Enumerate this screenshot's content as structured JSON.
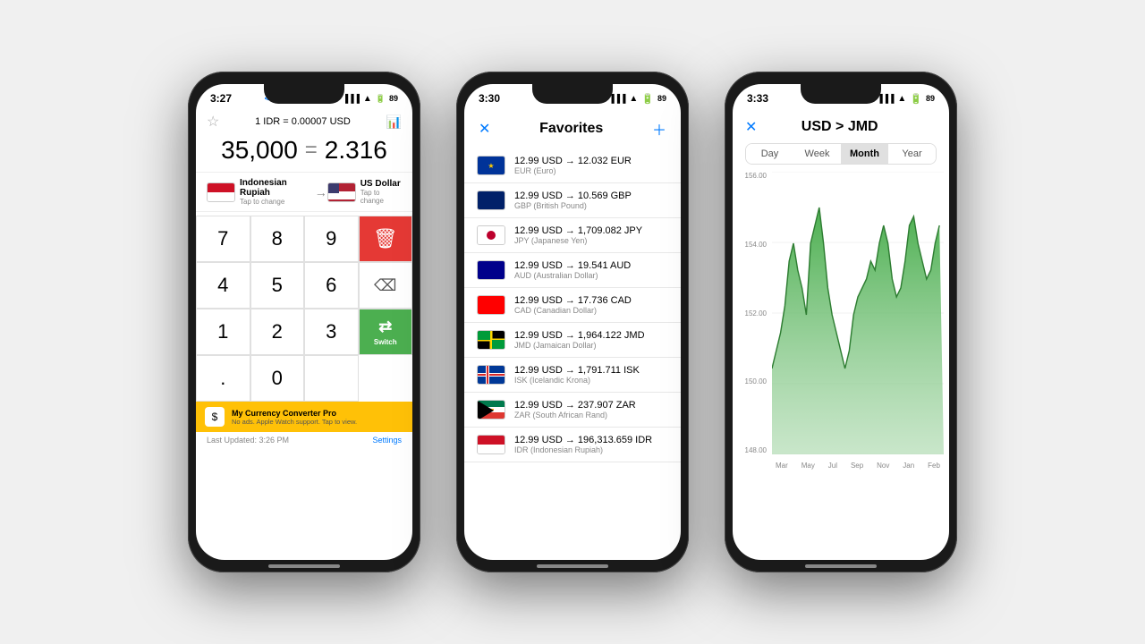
{
  "background": "#e8e8e8",
  "phone1": {
    "status": {
      "time": "3:27",
      "back": "< App Store",
      "battery": "89"
    },
    "rate": "1 IDR = 0.00007 USD",
    "input": "35,000",
    "equals": "=",
    "result": "2.316",
    "from_currency": "Indonesian Rupiah",
    "from_tap": "Tap to change",
    "to_currency": "US Dollar",
    "to_tap": "Tap to change",
    "keys": [
      "7",
      "8",
      "9",
      "DEL",
      "4",
      "5",
      "6",
      "⌫",
      "1",
      "2",
      "3",
      "",
      ".",
      "0",
      "",
      "Switch"
    ],
    "banner_title": "My Currency Converter Pro",
    "banner_sub": "No ads. Apple Watch support. Tap to view.",
    "footer_left": "Last Updated: 3:26 PM",
    "footer_right": "Settings"
  },
  "phone2": {
    "status": {
      "time": "3:30"
    },
    "title": "Favorites",
    "items": [
      {
        "flag": "eu",
        "text": "12.99 USD → 12.032 EUR",
        "sub": "EUR (Euro)"
      },
      {
        "flag": "gb",
        "text": "12.99 USD → 10.569 GBP",
        "sub": "GBP (British Pound)"
      },
      {
        "flag": "jp",
        "text": "12.99 USD → 1,709.082 JPY",
        "sub": "JPY (Japanese Yen)"
      },
      {
        "flag": "au",
        "text": "12.99 USD → 19.541 AUD",
        "sub": "AUD (Australian Dollar)"
      },
      {
        "flag": "ca",
        "text": "12.99 USD → 17.736 CAD",
        "sub": "CAD (Canadian Dollar)"
      },
      {
        "flag": "jm",
        "text": "12.99 USD → 1,964.122 JMD",
        "sub": "JMD (Jamaican Dollar)"
      },
      {
        "flag": "is",
        "text": "12.99 USD → 1,791.711 ISK",
        "sub": "ISK (Icelandic Krona)"
      },
      {
        "flag": "za",
        "text": "12.99 USD → 237.907 ZAR",
        "sub": "ZAR (South African Rand)"
      },
      {
        "flag": "id",
        "text": "12.99 USD → 196,313.659 IDR",
        "sub": "IDR (Indonesian Rupiah)"
      }
    ]
  },
  "phone3": {
    "status": {
      "time": "3:33"
    },
    "title": "USD > JMD",
    "tabs": [
      "Day",
      "Week",
      "Month",
      "Year"
    ],
    "active_tab": "Month",
    "y_labels": [
      "156.00",
      "154.00",
      "152.00",
      "150.00",
      "148.00"
    ],
    "x_labels": [
      "Mar",
      "May",
      "Jul",
      "Sep",
      "Nov",
      "Jan",
      "Feb"
    ]
  }
}
